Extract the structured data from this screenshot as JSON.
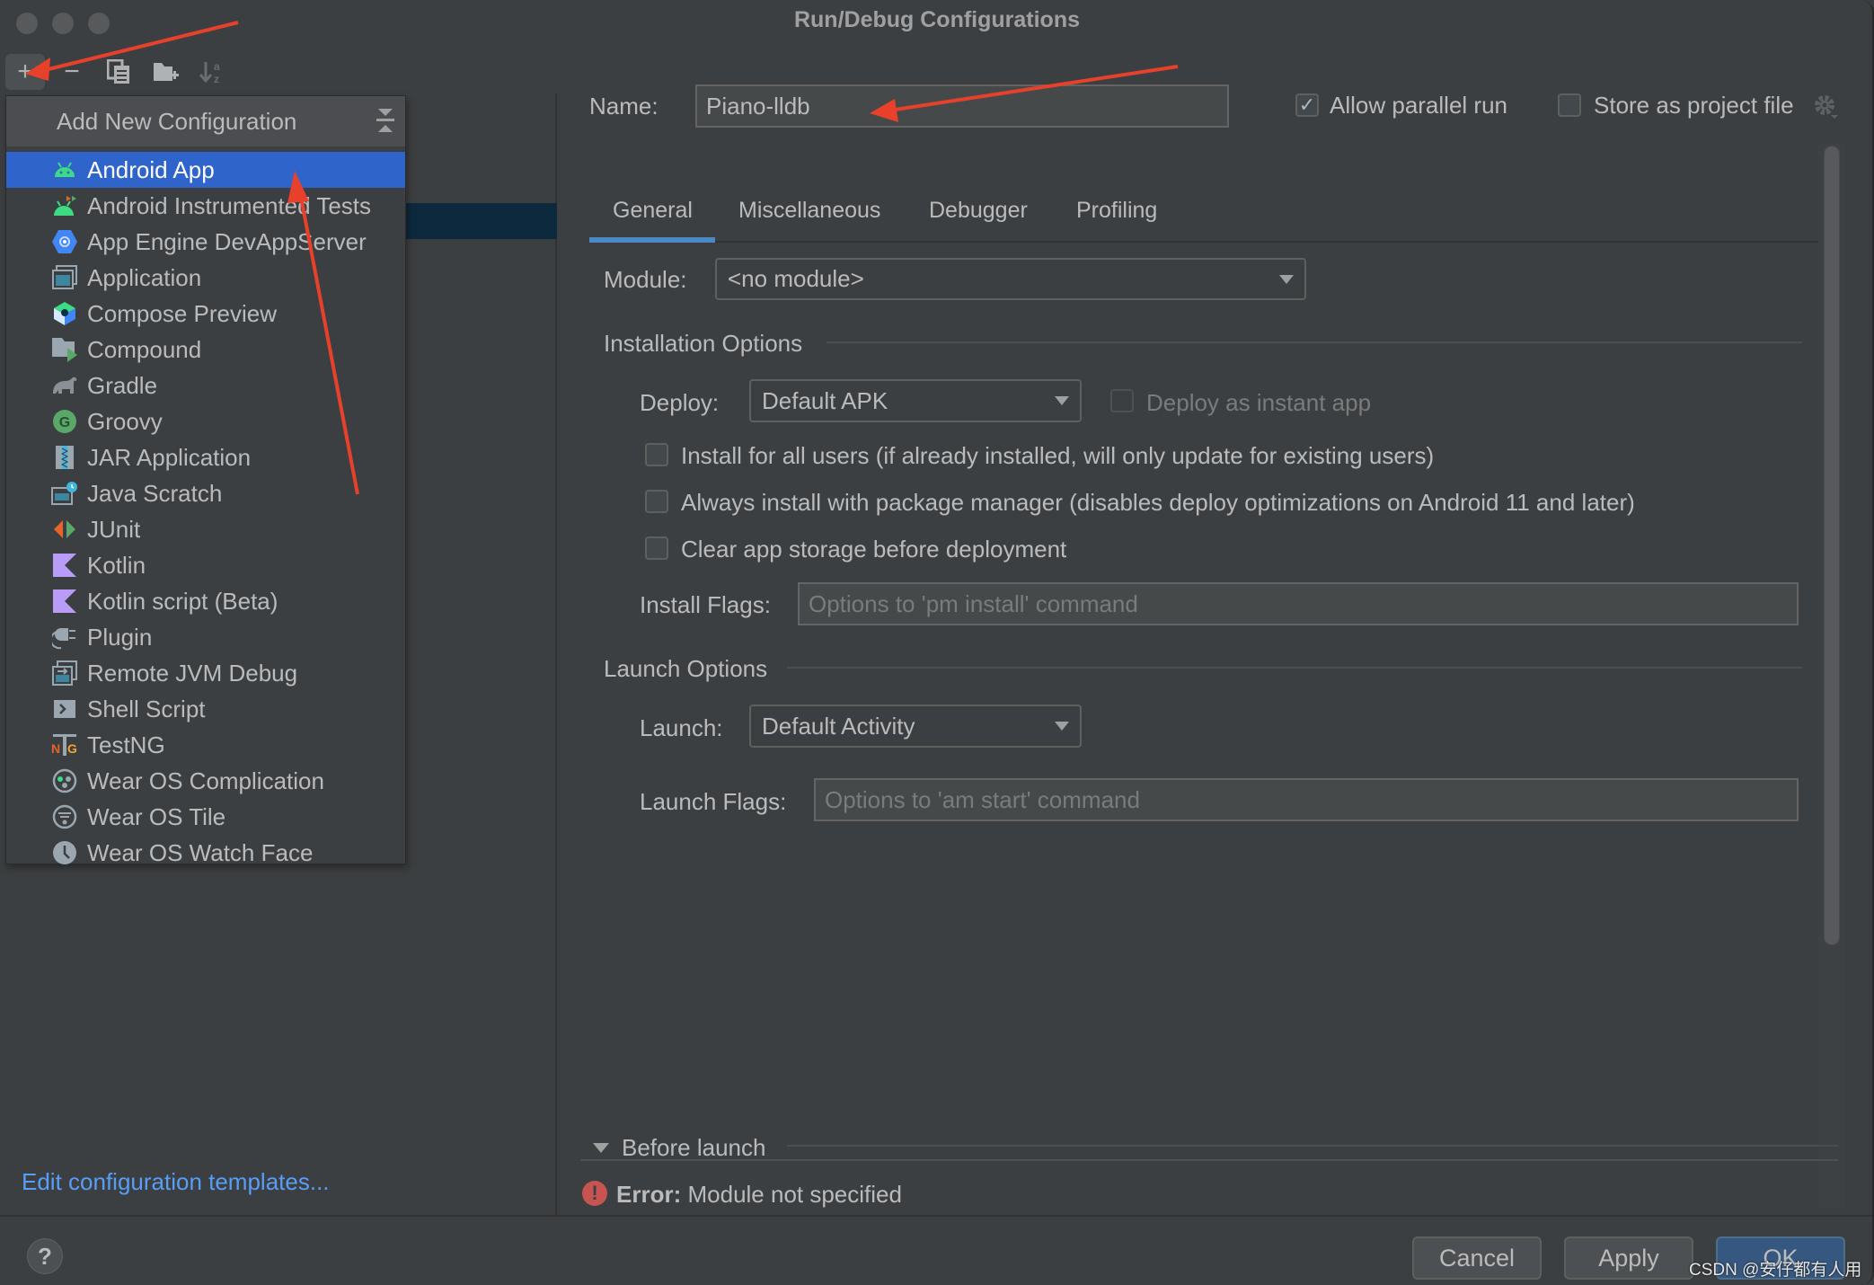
{
  "window": {
    "title": "Run/Debug Configurations"
  },
  "toolbar": {
    "add": "+",
    "remove": "−",
    "copy_icon": "copy-icon",
    "folder_icon": "new-folder-icon",
    "sort_icon": "sort-alphabetically-icon"
  },
  "popup": {
    "header": "Add New Configuration",
    "items": [
      {
        "label": "Android App",
        "icon": "android-icon",
        "selected": true
      },
      {
        "label": "Android Instrumented Tests",
        "icon": "android-test-icon"
      },
      {
        "label": "App Engine DevAppServer",
        "icon": "app-engine-icon"
      },
      {
        "label": "Application",
        "icon": "application-icon"
      },
      {
        "label": "Compose Preview",
        "icon": "compose-preview-icon"
      },
      {
        "label": "Compound",
        "icon": "compound-icon"
      },
      {
        "label": "Gradle",
        "icon": "gradle-icon"
      },
      {
        "label": "Groovy",
        "icon": "groovy-icon"
      },
      {
        "label": "JAR Application",
        "icon": "jar-icon"
      },
      {
        "label": "Java Scratch",
        "icon": "java-scratch-icon"
      },
      {
        "label": "JUnit",
        "icon": "junit-icon"
      },
      {
        "label": "Kotlin",
        "icon": "kotlin-icon"
      },
      {
        "label": "Kotlin script (Beta)",
        "icon": "kotlin-script-icon"
      },
      {
        "label": "Plugin",
        "icon": "plugin-icon"
      },
      {
        "label": "Remote JVM Debug",
        "icon": "remote-debug-icon"
      },
      {
        "label": "Shell Script",
        "icon": "shell-script-icon"
      },
      {
        "label": "TestNG",
        "icon": "testng-icon"
      },
      {
        "label": "Wear OS Complication",
        "icon": "wear-complication-icon"
      },
      {
        "label": "Wear OS Tile",
        "icon": "wear-tile-icon"
      },
      {
        "label": "Wear OS Watch Face",
        "icon": "wear-watchface-icon"
      }
    ]
  },
  "left_panel": {
    "edit_templates_link": "Edit configuration templates..."
  },
  "form": {
    "name_label": "Name:",
    "name_value": "Piano-lldb",
    "allow_parallel_label": "Allow parallel run",
    "allow_parallel_checked": true,
    "store_project_label": "Store as project file",
    "store_project_checked": false,
    "tabs": [
      "General",
      "Miscellaneous",
      "Debugger",
      "Profiling"
    ],
    "active_tab": "General",
    "module_label": "Module:",
    "module_value": "<no module>",
    "installation_section": "Installation Options",
    "deploy_label": "Deploy:",
    "deploy_value": "Default APK",
    "instant_app_label": "Deploy as instant app",
    "instant_app_checked": false,
    "checkboxes": [
      {
        "label": "Install for all users (if already installed, will only update for existing users)",
        "checked": false
      },
      {
        "label": "Always install with package manager (disables deploy optimizations on Android 11 and later)",
        "checked": false
      },
      {
        "label": "Clear app storage before deployment",
        "checked": false
      }
    ],
    "install_flags_label": "Install Flags:",
    "install_flags_placeholder": "Options to 'pm install' command",
    "launch_section": "Launch Options",
    "launch_label": "Launch:",
    "launch_value": "Default Activity",
    "launch_flags_label": "Launch Flags:",
    "launch_flags_placeholder": "Options to 'am start' command",
    "before_launch_label": "Before launch",
    "error_prefix": "Error:",
    "error_message": "Module not specified"
  },
  "buttons": {
    "help": "?",
    "cancel": "Cancel",
    "apply": "Apply",
    "ok": "OK"
  },
  "colors": {
    "accent": "#2f65ca",
    "link": "#589df6",
    "error": "#c75450",
    "annotation_arrow": "#e8412b"
  },
  "watermark": "CSDN @安仔都有人用"
}
